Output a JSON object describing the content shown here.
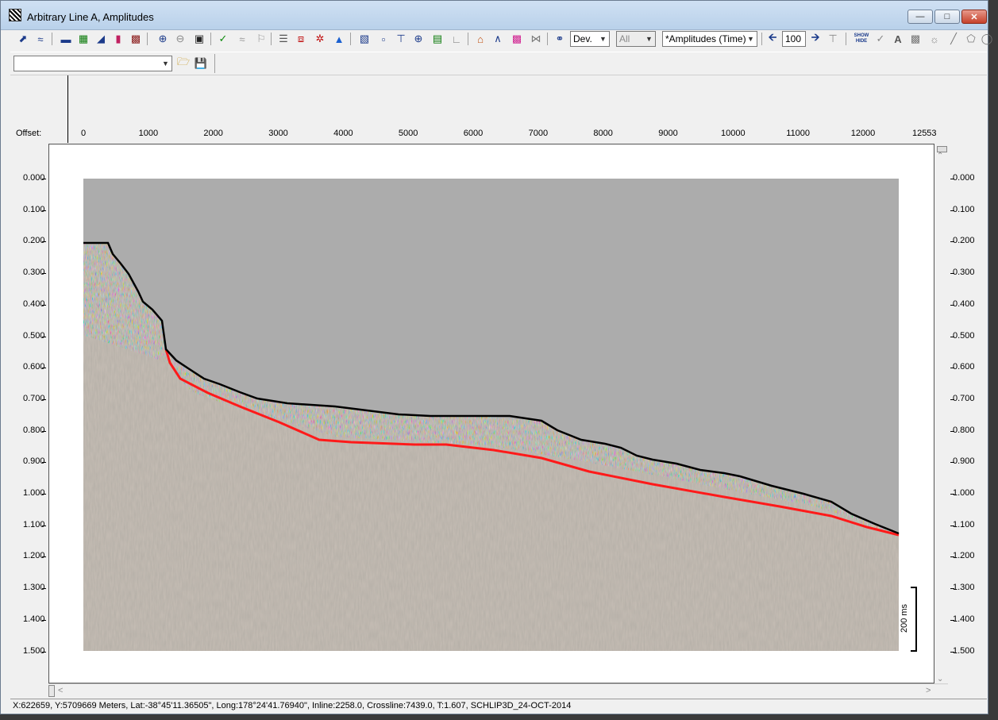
{
  "window": {
    "title": "Arbitrary Line A, Amplitudes",
    "minimize_icon": "minimize-icon",
    "maximize_icon": "maximize-icon",
    "close_icon": "close-icon"
  },
  "toolbar": {
    "dev_combo": "Dev.",
    "all_combo": "All",
    "amplitude_combo": "*Amplitudes (Time)",
    "step_value": "100",
    "show_hide_label": "SHOW HIDE"
  },
  "toolbar2": {
    "selector_value": ""
  },
  "header": {
    "offset_label": "Offset:",
    "offsets": [
      "0",
      "1000",
      "2000",
      "3000",
      "4000",
      "5000",
      "6000",
      "7000",
      "8000",
      "9000",
      "10000",
      "11000",
      "12000",
      "12553"
    ]
  },
  "time_axis": [
    "0.000",
    "0.100",
    "0.200",
    "0.300",
    "0.400",
    "0.500",
    "0.600",
    "0.700",
    "0.800",
    "0.900",
    "1.000",
    "1.100",
    "1.200",
    "1.300",
    "1.400",
    "1.500"
  ],
  "time_axis_right": [
    "0.000",
    "0.100",
    "0.200",
    "0.300",
    "0.400",
    "0.500",
    "0.600",
    "0.700",
    "0.800",
    "0.900",
    "1.000",
    "1.100",
    "1.200",
    "1.300",
    "1.400",
    "1.500"
  ],
  "scale_bar": "200 ms",
  "status": "X:622659,  Y:5709669 Meters, Lat:-38°45'11.36505\", Long:178°24'41.76940\",   Inline:2258.0,  Crossline:7439.0,  T:1.607,  SCHLIP3D_24-OCT-2014",
  "colors": {
    "seafloor_horizon": "#000000",
    "red_horizon": "#ff1a1a",
    "water": "#aaaaaa"
  }
}
